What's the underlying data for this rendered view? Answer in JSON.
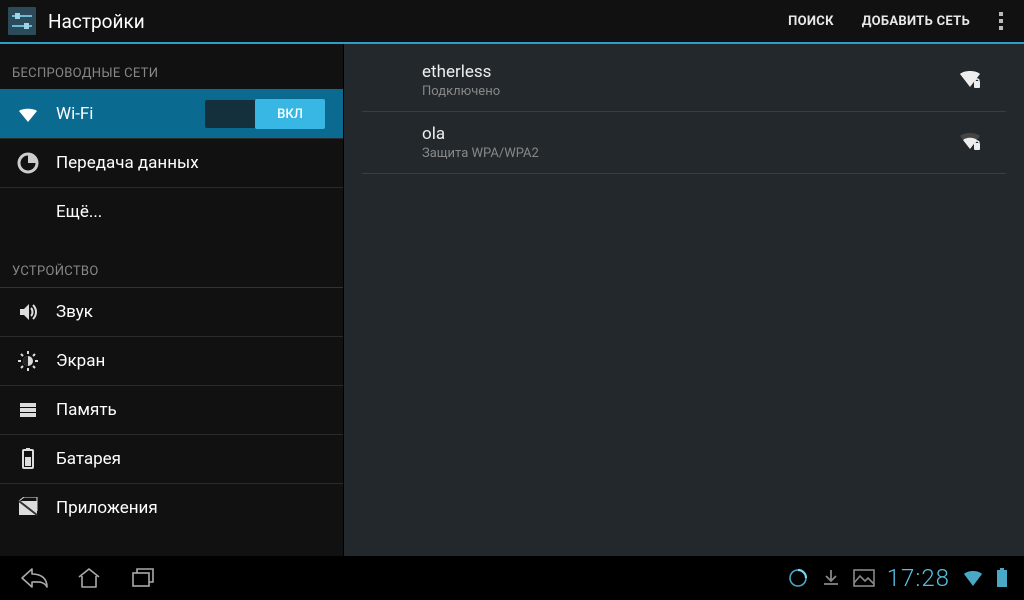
{
  "actionbar": {
    "title": "Настройки",
    "search_label": "ПОИСК",
    "add_network_label": "ДОБАВИТЬ СЕТЬ"
  },
  "sidebar": {
    "section_wireless": "БЕСПРОВОДНЫЕ СЕТИ",
    "section_device": "УСТРОЙСТВО",
    "items": {
      "wifi": "Wi-Fi",
      "data": "Передача данных",
      "more": "Ещё...",
      "sound": "Звук",
      "display": "Экран",
      "storage": "Память",
      "battery": "Батарея",
      "apps": "Приложения"
    },
    "wifi_toggle_label": "ВКЛ"
  },
  "networks": [
    {
      "ssid": "etherless",
      "status": "Подключено",
      "secured": true,
      "connected": true
    },
    {
      "ssid": "ola",
      "status": "Защита WPA/WPA2",
      "secured": true,
      "connected": false
    }
  ],
  "statusbar": {
    "clock": "17:28"
  }
}
